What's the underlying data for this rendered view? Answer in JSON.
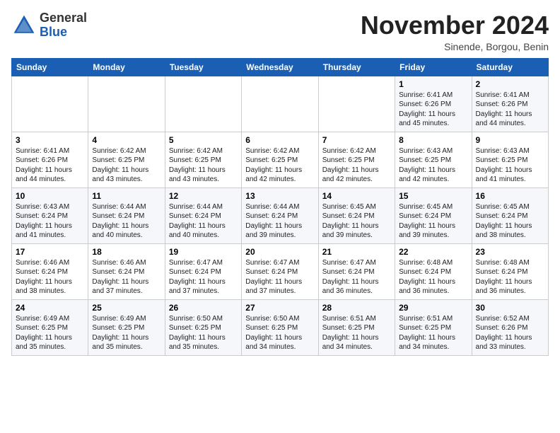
{
  "header": {
    "logo_general": "General",
    "logo_blue": "Blue",
    "month_title": "November 2024",
    "location": "Sinende, Borgou, Benin"
  },
  "days_of_week": [
    "Sunday",
    "Monday",
    "Tuesday",
    "Wednesday",
    "Thursday",
    "Friday",
    "Saturday"
  ],
  "weeks": [
    [
      {
        "day": "",
        "info": ""
      },
      {
        "day": "",
        "info": ""
      },
      {
        "day": "",
        "info": ""
      },
      {
        "day": "",
        "info": ""
      },
      {
        "day": "",
        "info": ""
      },
      {
        "day": "1",
        "info": "Sunrise: 6:41 AM\nSunset: 6:26 PM\nDaylight: 11 hours and 45 minutes."
      },
      {
        "day": "2",
        "info": "Sunrise: 6:41 AM\nSunset: 6:26 PM\nDaylight: 11 hours and 44 minutes."
      }
    ],
    [
      {
        "day": "3",
        "info": "Sunrise: 6:41 AM\nSunset: 6:26 PM\nDaylight: 11 hours and 44 minutes."
      },
      {
        "day": "4",
        "info": "Sunrise: 6:42 AM\nSunset: 6:25 PM\nDaylight: 11 hours and 43 minutes."
      },
      {
        "day": "5",
        "info": "Sunrise: 6:42 AM\nSunset: 6:25 PM\nDaylight: 11 hours and 43 minutes."
      },
      {
        "day": "6",
        "info": "Sunrise: 6:42 AM\nSunset: 6:25 PM\nDaylight: 11 hours and 42 minutes."
      },
      {
        "day": "7",
        "info": "Sunrise: 6:42 AM\nSunset: 6:25 PM\nDaylight: 11 hours and 42 minutes."
      },
      {
        "day": "8",
        "info": "Sunrise: 6:43 AM\nSunset: 6:25 PM\nDaylight: 11 hours and 42 minutes."
      },
      {
        "day": "9",
        "info": "Sunrise: 6:43 AM\nSunset: 6:25 PM\nDaylight: 11 hours and 41 minutes."
      }
    ],
    [
      {
        "day": "10",
        "info": "Sunrise: 6:43 AM\nSunset: 6:24 PM\nDaylight: 11 hours and 41 minutes."
      },
      {
        "day": "11",
        "info": "Sunrise: 6:44 AM\nSunset: 6:24 PM\nDaylight: 11 hours and 40 minutes."
      },
      {
        "day": "12",
        "info": "Sunrise: 6:44 AM\nSunset: 6:24 PM\nDaylight: 11 hours and 40 minutes."
      },
      {
        "day": "13",
        "info": "Sunrise: 6:44 AM\nSunset: 6:24 PM\nDaylight: 11 hours and 39 minutes."
      },
      {
        "day": "14",
        "info": "Sunrise: 6:45 AM\nSunset: 6:24 PM\nDaylight: 11 hours and 39 minutes."
      },
      {
        "day": "15",
        "info": "Sunrise: 6:45 AM\nSunset: 6:24 PM\nDaylight: 11 hours and 39 minutes."
      },
      {
        "day": "16",
        "info": "Sunrise: 6:45 AM\nSunset: 6:24 PM\nDaylight: 11 hours and 38 minutes."
      }
    ],
    [
      {
        "day": "17",
        "info": "Sunrise: 6:46 AM\nSunset: 6:24 PM\nDaylight: 11 hours and 38 minutes."
      },
      {
        "day": "18",
        "info": "Sunrise: 6:46 AM\nSunset: 6:24 PM\nDaylight: 11 hours and 37 minutes."
      },
      {
        "day": "19",
        "info": "Sunrise: 6:47 AM\nSunset: 6:24 PM\nDaylight: 11 hours and 37 minutes."
      },
      {
        "day": "20",
        "info": "Sunrise: 6:47 AM\nSunset: 6:24 PM\nDaylight: 11 hours and 37 minutes."
      },
      {
        "day": "21",
        "info": "Sunrise: 6:47 AM\nSunset: 6:24 PM\nDaylight: 11 hours and 36 minutes."
      },
      {
        "day": "22",
        "info": "Sunrise: 6:48 AM\nSunset: 6:24 PM\nDaylight: 11 hours and 36 minutes."
      },
      {
        "day": "23",
        "info": "Sunrise: 6:48 AM\nSunset: 6:24 PM\nDaylight: 11 hours and 36 minutes."
      }
    ],
    [
      {
        "day": "24",
        "info": "Sunrise: 6:49 AM\nSunset: 6:25 PM\nDaylight: 11 hours and 35 minutes."
      },
      {
        "day": "25",
        "info": "Sunrise: 6:49 AM\nSunset: 6:25 PM\nDaylight: 11 hours and 35 minutes."
      },
      {
        "day": "26",
        "info": "Sunrise: 6:50 AM\nSunset: 6:25 PM\nDaylight: 11 hours and 35 minutes."
      },
      {
        "day": "27",
        "info": "Sunrise: 6:50 AM\nSunset: 6:25 PM\nDaylight: 11 hours and 34 minutes."
      },
      {
        "day": "28",
        "info": "Sunrise: 6:51 AM\nSunset: 6:25 PM\nDaylight: 11 hours and 34 minutes."
      },
      {
        "day": "29",
        "info": "Sunrise: 6:51 AM\nSunset: 6:25 PM\nDaylight: 11 hours and 34 minutes."
      },
      {
        "day": "30",
        "info": "Sunrise: 6:52 AM\nSunset: 6:26 PM\nDaylight: 11 hours and 33 minutes."
      }
    ]
  ]
}
